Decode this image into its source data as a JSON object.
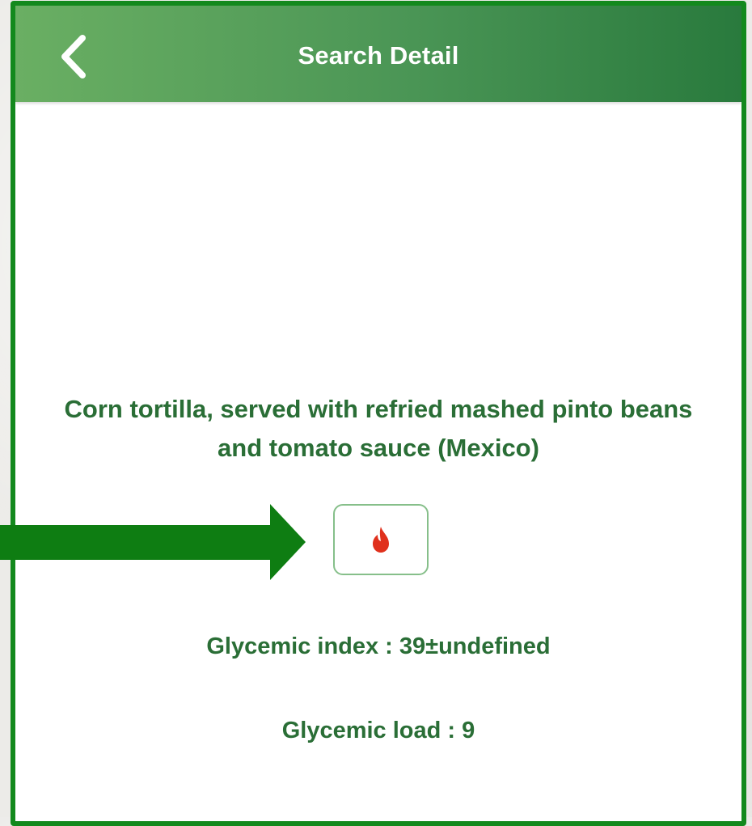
{
  "header": {
    "title": "Search Detail",
    "back_icon": "chevron-left-icon",
    "gradient": [
      "#6aaf63",
      "#297a3d"
    ]
  },
  "food": {
    "name": "Corn tortilla, served with refried mashed pinto beans and tomato sauce (Mexico)"
  },
  "action": {
    "icon": "flame-icon",
    "icon_color": "#e0301c"
  },
  "nutrition": {
    "glycemic_index": "Glycemic index : 39±undefined",
    "glycemic_load": "Glycemic load : 9"
  },
  "annotation": {
    "type": "arrow-right",
    "color": "#0e7d12"
  },
  "colors": {
    "frame_border": "#13891d",
    "text_green": "#2a6e36",
    "button_border": "#86bf8a"
  }
}
